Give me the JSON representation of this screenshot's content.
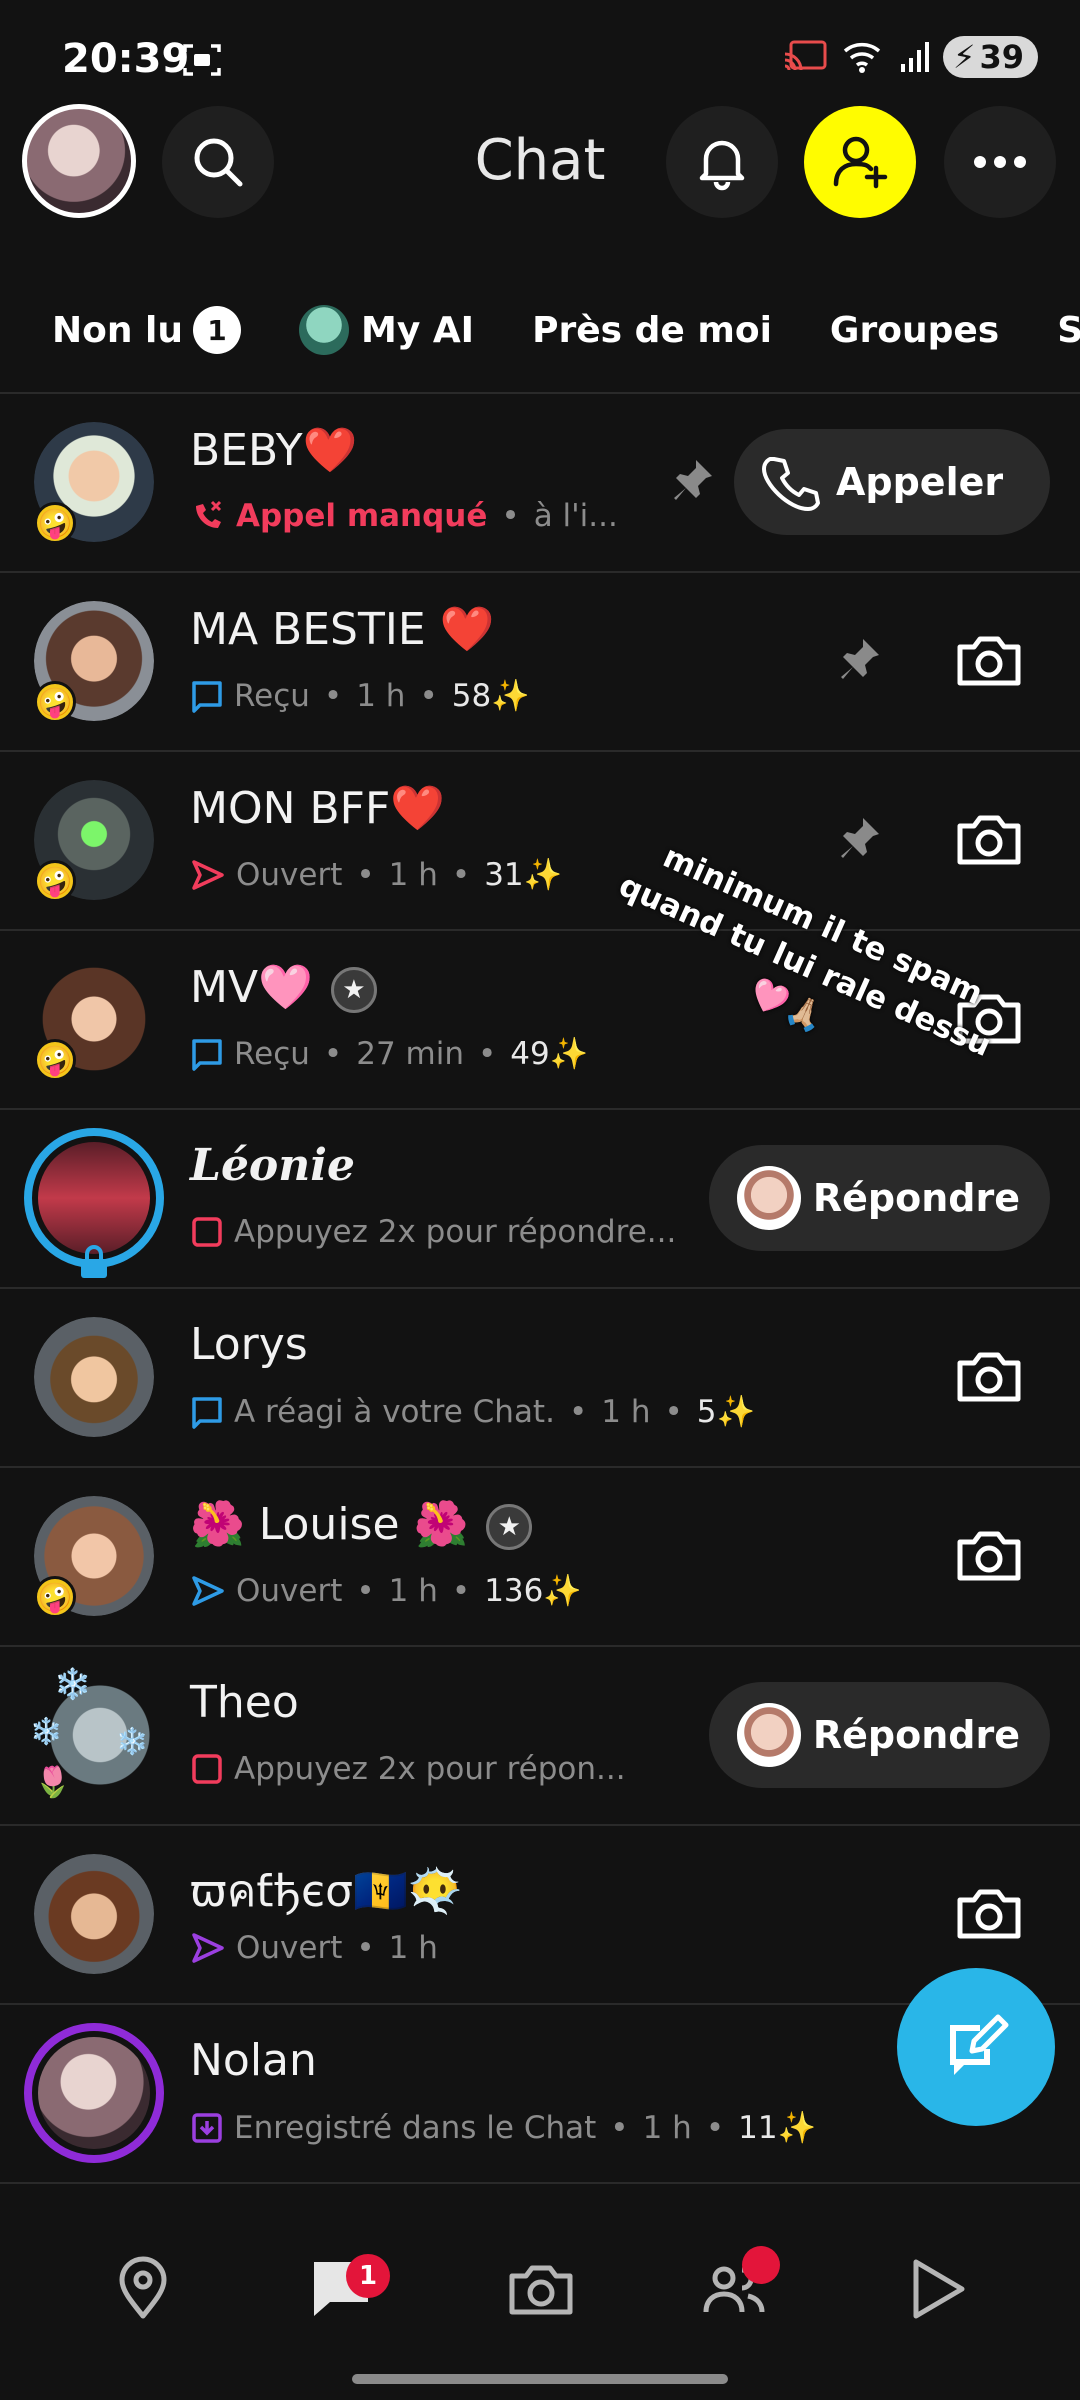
{
  "status_bar": {
    "time": "20:39",
    "battery": "39"
  },
  "header": {
    "title": "Chat"
  },
  "tabs": [
    {
      "label": "Non lu",
      "badge": "1"
    },
    {
      "label": "My AI"
    },
    {
      "label": "Près de moi"
    },
    {
      "label": "Groupes"
    },
    {
      "label": "Sans"
    }
  ],
  "chats": [
    {
      "name": "BEBY❤️",
      "status": "Appel manqué",
      "time": "à l'i...",
      "action": "Appeler"
    },
    {
      "name": "MA BESTIE ❤️",
      "status": "Reçu",
      "time": "1 h",
      "streak": "58✨"
    },
    {
      "name": "MON BFF❤️",
      "status": "Ouvert",
      "time": "1 h",
      "streak": "31✨"
    },
    {
      "name": "MV🩷",
      "status": "Reçu",
      "time": "27 min",
      "streak": "49✨"
    },
    {
      "name": "Léonie",
      "status": "Appuyez 2x pour répondre...",
      "action": "Répondre"
    },
    {
      "name": "Lorys",
      "status": "A réagi à votre Chat.",
      "time": "1 h",
      "streak": "5✨"
    },
    {
      "name": "🌺 Louise 🌺",
      "status": "Ouvert",
      "time": "1 h",
      "streak": "136✨"
    },
    {
      "name": "Theo",
      "status": "Appuyez 2x pour répon...",
      "action": "Répondre"
    },
    {
      "name": "ϖคƭђєσ🇧🇧😶‍🌫️",
      "status": "Ouvert",
      "time": "1 h"
    },
    {
      "name": "Nolan",
      "status": "Enregistré dans le Chat",
      "time": "1 h",
      "streak": "11✨"
    }
  ],
  "overlay_text": {
    "line1": "minimum il te spam",
    "line2": "quand tu lui rale dessu",
    "line3": "🩷🙏🏼"
  },
  "bottom_nav": {
    "chat_badge": "1"
  },
  "colors": {
    "accent_yellow": "#FFFC00",
    "missed_red": "#F23C5C",
    "received_blue": "#2E9BE6",
    "opened_red": "#F23C5C",
    "fab_blue": "#29B6E8"
  }
}
